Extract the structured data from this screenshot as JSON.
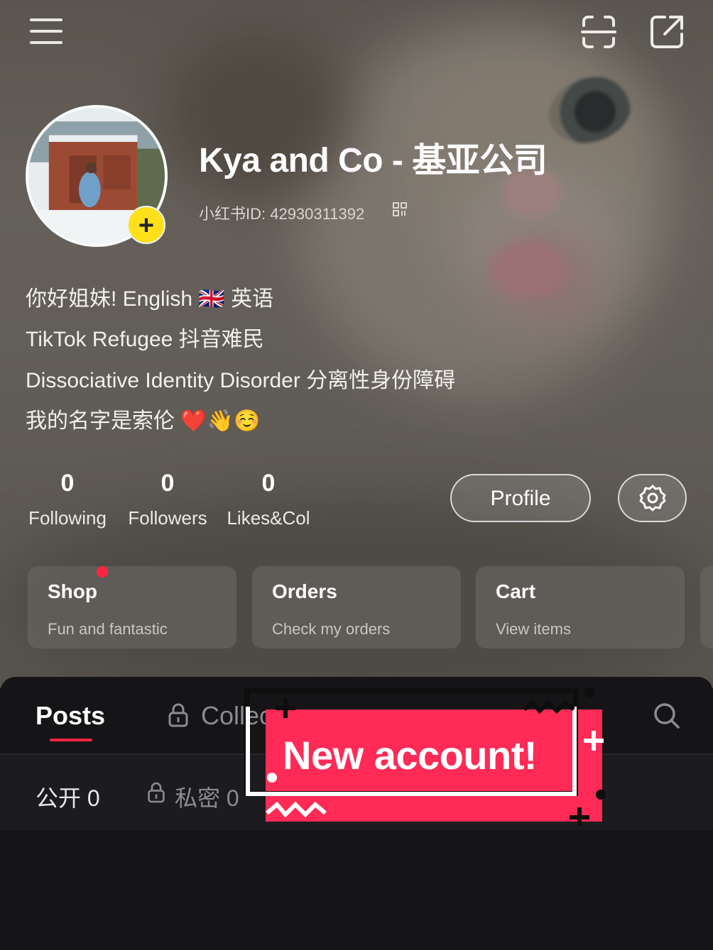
{
  "header": {
    "menu_icon": "menu-icon",
    "scan_icon": "scan-icon",
    "share_icon": "share-icon"
  },
  "profile": {
    "name": "Kya and Co - 基亚公司",
    "id_text": "小红书ID: 42930311392",
    "avatar_plus": "+",
    "bio": [
      "你好姐妹! English 🇬🇧 英语",
      "TikTok Refugee 抖音难民",
      "Dissociative Identity Disorder 分离性身份障碍",
      "我的名字是索伦 ❤️👋☺️"
    ]
  },
  "stats": [
    {
      "value": "0",
      "label": "Following"
    },
    {
      "value": "0",
      "label": "Followers"
    },
    {
      "value": "0",
      "label": "Likes&Col"
    }
  ],
  "buttons": {
    "profile": "Profile",
    "settings_icon": "gear-icon"
  },
  "cards": [
    {
      "title": "Shop",
      "subtitle": "Fun and fantastic"
    },
    {
      "title": "Orders",
      "subtitle": "Check my orders"
    },
    {
      "title": "Cart",
      "subtitle": "View items"
    }
  ],
  "tabs": {
    "posts": "Posts",
    "collects": "Collec"
  },
  "subtabs": {
    "public": "公开 0",
    "private": "私密 0"
  },
  "sticker": {
    "text": "New account!"
  },
  "colors": {
    "accent": "#ff2442",
    "sticker": "#ff2a55",
    "badge": "#ffe01b"
  }
}
